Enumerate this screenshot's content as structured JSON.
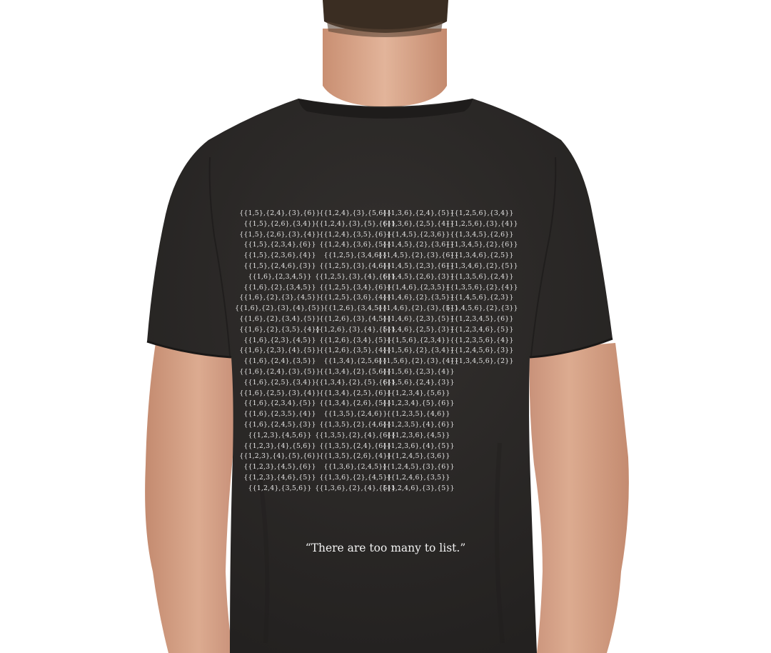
{
  "shirt_print": {
    "columns": [
      [
        "{{1,5},{2,4},{3},{6}}",
        "{{1,5},{2,6},{3,4}}",
        "{{1,5},{2,6},{3},{4}}",
        "{{1,5},{2,3,4},{6}}",
        "{{1,5},{2,3,6},{4}}",
        "{{1,5},{2,4,6},{3}}",
        "{{1,6},{2,3,4,5}}",
        "{{1,6},{2},{3,4,5}}",
        "{{1,6},{2},{3},{4,5}}",
        "{{1,6},{2},{3},{4},{5}}",
        "{{1,6},{2},{3,4},{5}}",
        "{{1,6},{2},{3,5},{4}}",
        "{{1,6},{2,3},{4,5}}",
        "{{1,6},{2,3},{4},{5}}",
        "{{1,6},{2,4},{3,5}}",
        "{{1,6},{2,4},{3},{5}}",
        "{{1,6},{2,5},{3,4}}",
        "{{1,6},{2,5},{3},{4}}",
        "{{1,6},{2,3,4},{5}}",
        "{{1,6},{2,3,5},{4}}",
        "{{1,6},{2,4,5},{3}}",
        "{{1,2,3},{4,5,6}}",
        "{{1,2,3},{4},{5,6}}",
        "{{1,2,3},{4},{5},{6}}",
        "{{1,2,3},{4,5},{6}}",
        "{{1,2,3},{4,6},{5}}",
        "{{1,2,4},{3,5,6}}"
      ],
      [
        "{{1,2,4},{3},{5,6}}",
        "{{1,2,4},{3},{5},{6}}",
        "{{1,2,4},{3,5},{6}}",
        "{{1,2,4},{3,6},{5}}",
        "{{1,2,5},{3,4,6}}",
        "{{1,2,5},{3},{4,6}}",
        "{{1,2,5},{3},{4},{6}}",
        "{{1,2,5},{3,4},{6}}",
        "{{1,2,5},{3,6},{4}}",
        "{{1,2,6},{3,4,5}}",
        "{{1,2,6},{3},{4,5}}",
        "{{1,2,6},{3},{4},{5}}",
        "{{1,2,6},{3,4},{5}}",
        "{{1,2,6},{3,5},{4}}",
        "{{1,3,4},{2,5,6}}",
        "{{1,3,4},{2},{5,6}}",
        "{{1,3,4},{2},{5},{6}}",
        "{{1,3,4},{2,5},{6}}",
        "{{1,3,4},{2,6},{5}}",
        "{{1,3,5},{2,4,6}}",
        "{{1,3,5},{2},{4,6}}",
        "{{1,3,5},{2},{4},{6}}",
        "{{1,3,5},{2,4},{6}}",
        "{{1,3,5},{2,6},{4}}",
        "{{1,3,6},{2,4,5}}",
        "{{1,3,6},{2},{4,5}}",
        "{{1,3,6},{2},{4},{5}}"
      ],
      [
        "{{1,3,6},{2,4},{5}}",
        "{{1,3,6},{2,5},{4}}",
        "{{1,4,5},{2,3,6}}",
        "{{1,4,5},{2},{3,6}}",
        "{{1,4,5},{2},{3},{6}}",
        "{{1,4,5},{2,3},{6}}",
        "{{1,4,5},{2,6},{3}}",
        "{{1,4,6},{2,3,5}}",
        "{{1,4,6},{2},{3,5}}",
        "{{1,4,6},{2},{3},{5}}",
        "{{1,4,6},{2,3},{5}}",
        "{{1,4,6},{2,5},{3}}",
        "{{1,5,6},{2,3,4}}",
        "{{1,5,6},{2},{3,4}}",
        "{{1,5,6},{2},{3},{4}}",
        "{{1,5,6},{2,3},{4}}",
        "{{1,5,6},{2,4},{3}}",
        "{{1,2,3,4},{5,6}}",
        "{{1,2,3,4},{5},{6}}",
        "{{1,2,3,5},{4,6}}",
        "{{1,2,3,5},{4},{6}}",
        "{{1,2,3,6},{4,5}}",
        "{{1,2,3,6},{4},{5}}",
        "{{1,2,4,5},{3,6}}",
        "{{1,2,4,5},{3},{6}}",
        "{{1,2,4,6},{3,5}}",
        "{{1,2,4,6},{3},{5}}"
      ],
      [
        "{{1,2,5,6},{3,4}}",
        "{{1,2,5,6},{3},{4}}",
        "{{1,3,4,5},{2,6}}",
        "{{1,3,4,5},{2},{6}}",
        "{{1,3,4,6},{2,5}}",
        "{{1,3,4,6},{2},{5}}",
        "{{1,3,5,6},{2,4}}",
        "{{1,3,5,6},{2},{4}}",
        "{{1,4,5,6},{2,3}}",
        "{{1,4,5,6},{2},{3}}",
        "{{1,2,3,4,5},{6}}",
        "{{1,2,3,4,6},{5}}",
        "{{1,2,3,5,6},{4}}",
        "{{1,2,4,5,6},{3}}",
        "{{1,3,4,5,6},{2}}"
      ]
    ],
    "quote": "“There are too many to list.”"
  },
  "colors": {
    "background": "#ffffff",
    "shirt": "#2b2927",
    "skin": "#d9a98e",
    "hair": "#3a2d22",
    "print_text": "#e4e4e4"
  }
}
